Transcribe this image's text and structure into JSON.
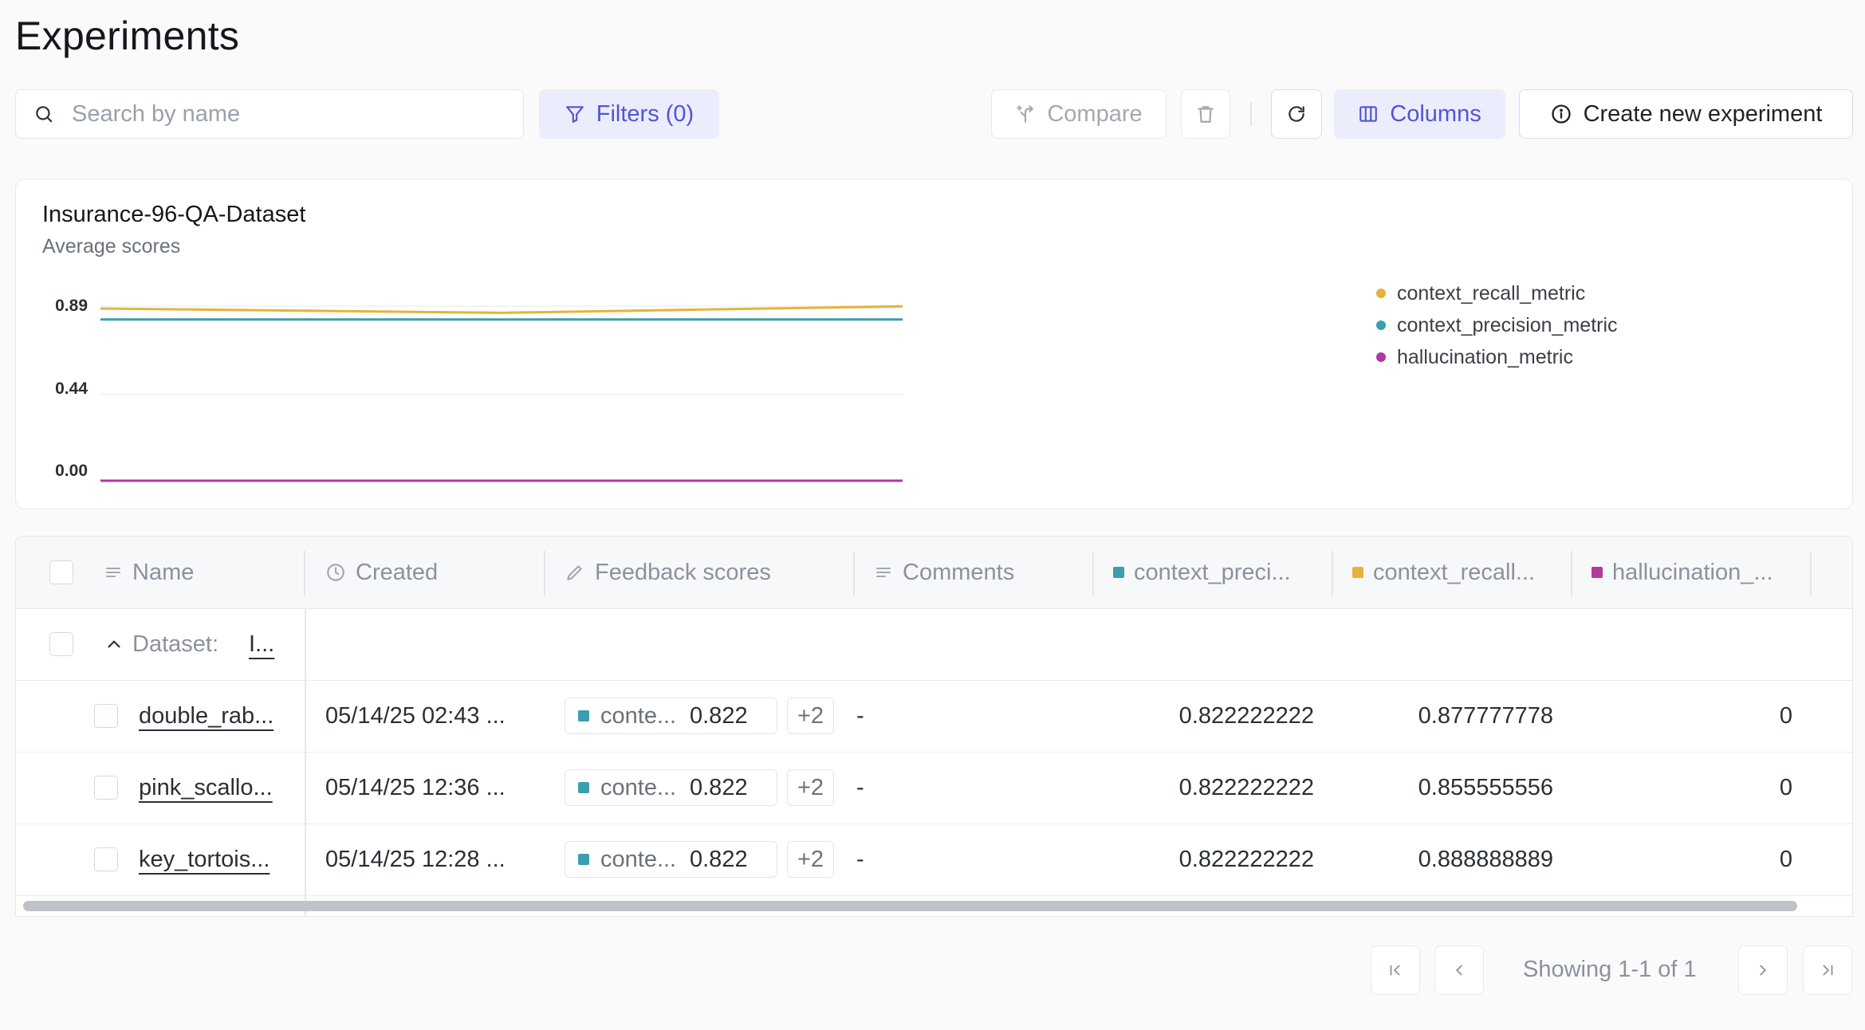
{
  "page": {
    "title": "Experiments"
  },
  "toolbar": {
    "search_placeholder": "Search by name",
    "filters_label": "Filters (0)",
    "compare_label": "Compare",
    "columns_label": "Columns",
    "create_label": "Create new experiment"
  },
  "chart": {
    "title": "Insurance-96-QA-Dataset",
    "subtitle": "Average scores",
    "y_ticks": [
      "0.89",
      "0.44",
      "0.00"
    ]
  },
  "chart_data": {
    "type": "line",
    "title": "Insurance-96-QA-Dataset",
    "subtitle": "Average scores",
    "ylim": [
      0,
      0.89
    ],
    "y_ticks": [
      0.89,
      0.44,
      0.0
    ],
    "grid": true,
    "legend_position": "right",
    "x": [
      0,
      1,
      2
    ],
    "series": [
      {
        "name": "context_recall_metric",
        "color": "#e8b23a",
        "values": [
          0.878,
          0.856,
          0.889
        ]
      },
      {
        "name": "context_precision_metric",
        "color": "#3a9fae",
        "values": [
          0.822,
          0.822,
          0.822
        ]
      },
      {
        "name": "hallucination_metric",
        "color": "#b3399a",
        "values": [
          0,
          0,
          0
        ]
      }
    ]
  },
  "table": {
    "headers": {
      "name": "Name",
      "created": "Created",
      "feedback": "Feedback scores",
      "comments": "Comments",
      "precision": "context_preci...",
      "recall": "context_recall...",
      "hallucination": "hallucination_..."
    },
    "group": {
      "label": "Dataset:",
      "value": "I..."
    },
    "rows": [
      {
        "name": "double_rab...",
        "created": "05/14/25 02:43 ...",
        "chip_name": "conte...",
        "chip_value": "0.822",
        "chip_more": "+2",
        "comments": "-",
        "precision": "0.822222222",
        "recall": "0.877777778",
        "hallucination": "0"
      },
      {
        "name": "pink_scallo...",
        "created": "05/14/25 12:36 ...",
        "chip_name": "conte...",
        "chip_value": "0.822",
        "chip_more": "+2",
        "comments": "-",
        "precision": "0.822222222",
        "recall": "0.855555556",
        "hallucination": "0"
      },
      {
        "name": "key_tortois...",
        "created": "05/14/25 12:28 ...",
        "chip_name": "conte...",
        "chip_value": "0.822",
        "chip_more": "+2",
        "comments": "-",
        "precision": "0.822222222",
        "recall": "0.888888889",
        "hallucination": "0"
      }
    ]
  },
  "pagination": {
    "text": "Showing 1-1 of 1"
  },
  "colors": {
    "accent": "#5154d6",
    "accent_bg": "#ebedfc",
    "recall": "#e8b23a",
    "precision": "#3a9fae",
    "hallucination": "#b3399a"
  }
}
